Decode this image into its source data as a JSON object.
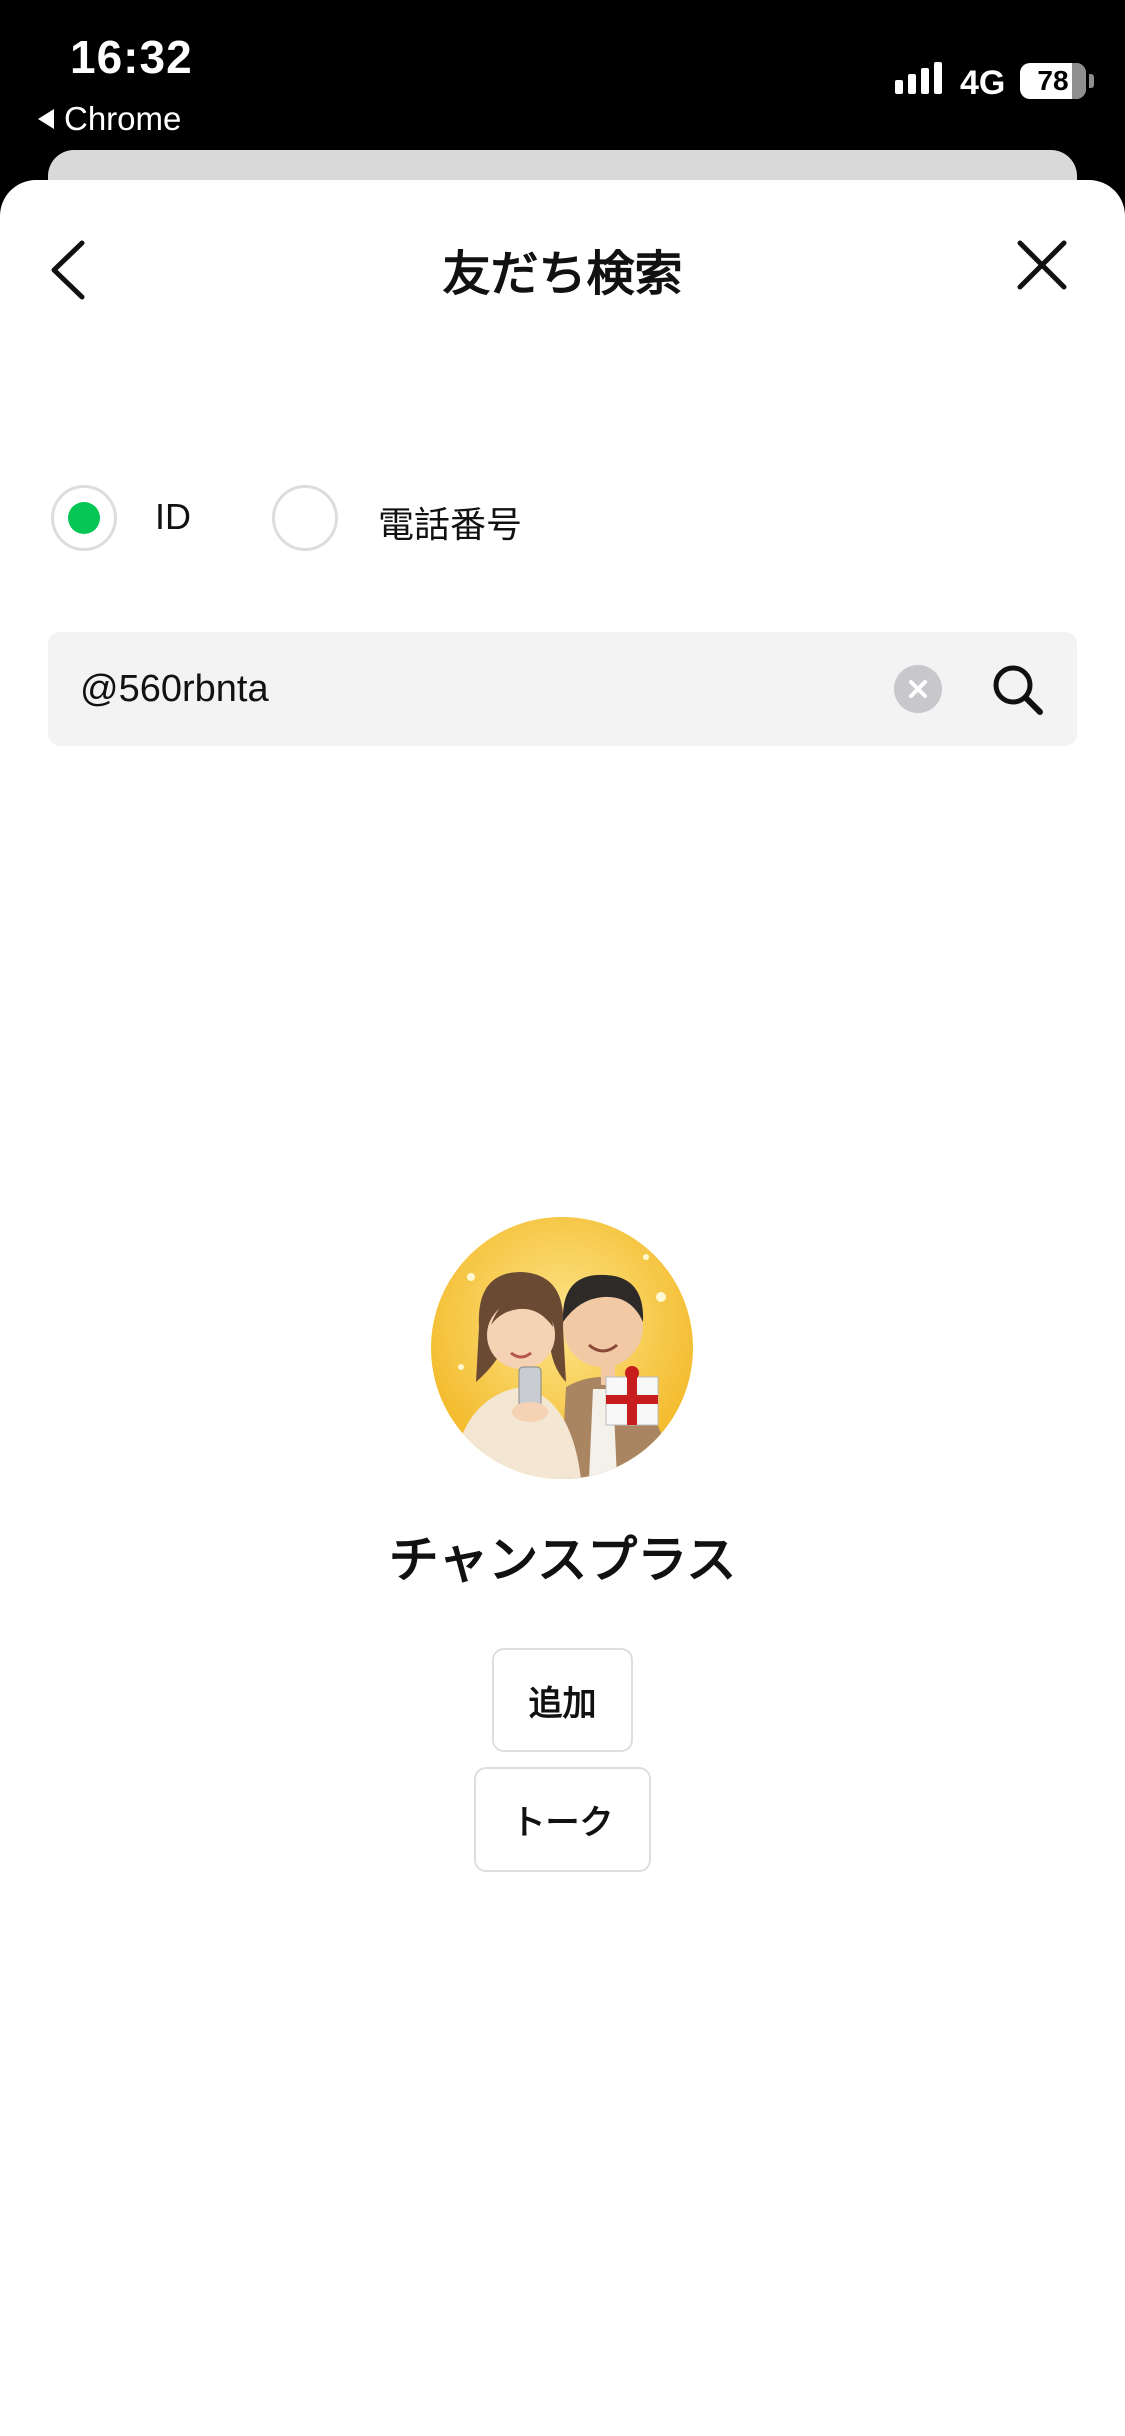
{
  "status_bar": {
    "time": "16:32",
    "back_app": "Chrome",
    "network": "4G",
    "battery": "78"
  },
  "header": {
    "title": "友だち検索"
  },
  "search_type": {
    "options": [
      {
        "label": "ID",
        "selected": true
      },
      {
        "label": "電話番号",
        "selected": false
      }
    ],
    "accent_color": "#06c755"
  },
  "search": {
    "value": "@560rbnta"
  },
  "result": {
    "name": "チャンスプラス",
    "add_label": "追加",
    "talk_label": "トーク"
  }
}
